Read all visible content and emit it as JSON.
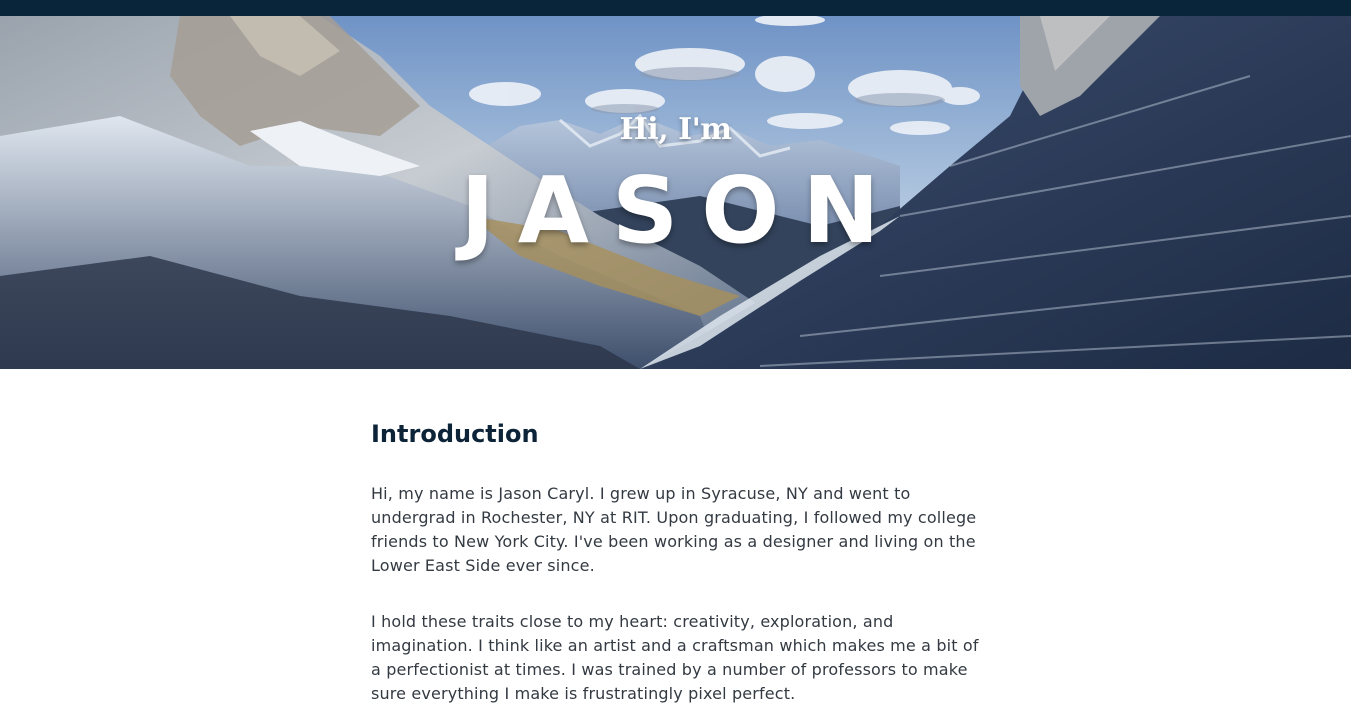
{
  "hero": {
    "greeting": "Hi, I'm",
    "name": "JASON"
  },
  "intro": {
    "title": "Introduction",
    "paragraphs": [
      "Hi, my name is Jason Caryl. I grew up in Syracuse, NY and went to undergrad in Rochester, NY at RIT. Upon graduating, I followed my college friends to New York City. I've been working as a designer and living on the Lower East Side ever since.",
      "I hold these traits close to my heart: creativity, exploration, and imagination. I think like an artist and a craftsman which makes me a bit of a perfectionist at times. I was trained by a number of professors to make sure everything I make is frustratingly pixel perfect."
    ]
  },
  "colors": {
    "topbar": "#08253a",
    "heading": "#0d2438",
    "body_text": "#333a42",
    "hero_text": "#ffffff"
  }
}
